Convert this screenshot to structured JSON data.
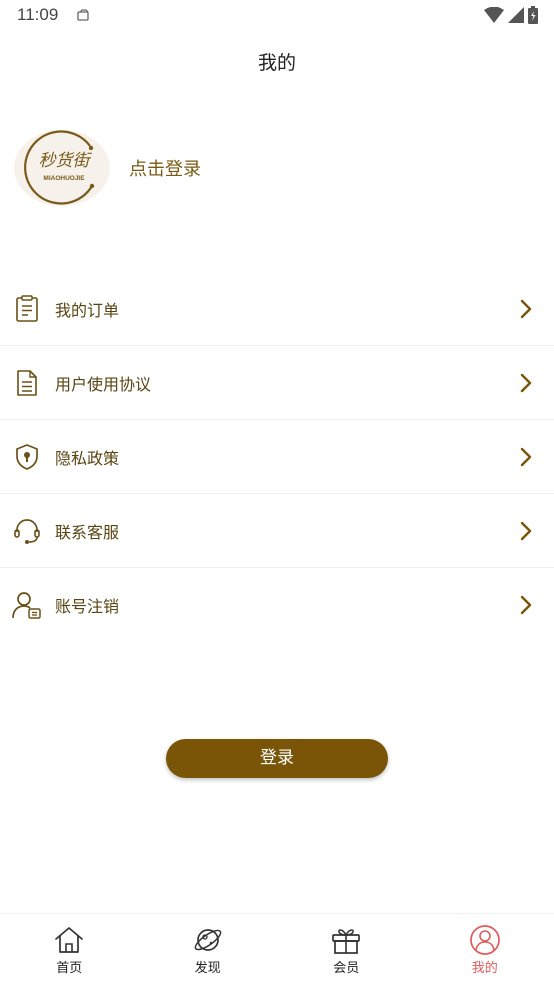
{
  "status_bar": {
    "time": "11:09"
  },
  "header": {
    "title": "我的"
  },
  "profile": {
    "login_prompt": "点击登录",
    "logo_text": "秒货街",
    "logo_subtext": "MIAOHUOJIE"
  },
  "menu": {
    "items": [
      {
        "label": "我的订单",
        "icon": "order-list-icon"
      },
      {
        "label": "用户使用协议",
        "icon": "document-icon"
      },
      {
        "label": "隐私政策",
        "icon": "shield-lock-icon"
      },
      {
        "label": "联系客服",
        "icon": "headset-icon"
      },
      {
        "label": "账号注销",
        "icon": "user-card-icon"
      }
    ]
  },
  "login_button": {
    "label": "登录"
  },
  "bottom_nav": {
    "items": [
      {
        "label": "首页",
        "icon": "home-icon",
        "active": false
      },
      {
        "label": "发现",
        "icon": "planet-icon",
        "active": false
      },
      {
        "label": "会员",
        "icon": "gift-icon",
        "active": false
      },
      {
        "label": "我的",
        "icon": "user-icon",
        "active": true
      }
    ]
  },
  "colors": {
    "accent": "#7a5508",
    "menu_text": "#5a4512",
    "active_tab": "#e25a5a"
  }
}
